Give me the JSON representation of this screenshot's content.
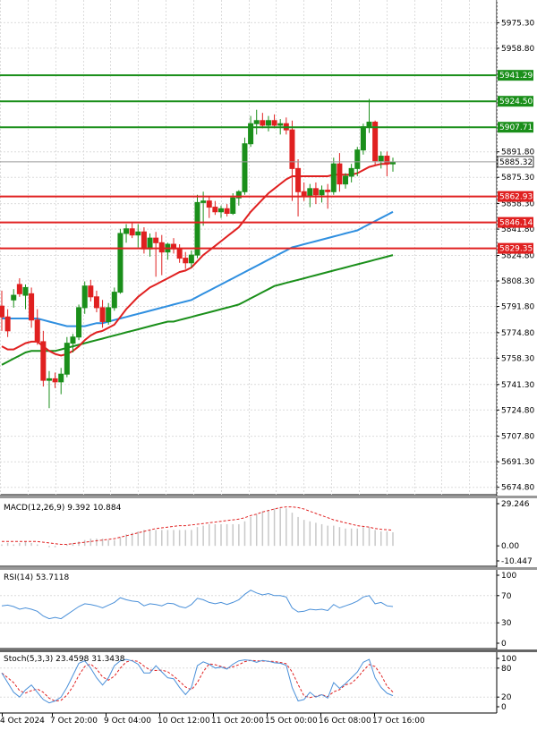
{
  "chart_data": [
    {
      "type": "candlestick",
      "y_ticks": [
        "5975.30",
        "5958.80",
        "5891.80",
        "5875.30",
        "5858.30",
        "5841.80",
        "5824.80",
        "5808.30",
        "5791.80",
        "5774.80",
        "5758.30",
        "5741.30",
        "5724.80",
        "5707.80",
        "5691.30",
        "5674.80"
      ],
      "ylim": [
        5670,
        5990
      ],
      "levels": [
        {
          "value": 5941.29,
          "label": "5941.29",
          "color": "#1a8f1a"
        },
        {
          "value": 5924.5,
          "label": "5924.50",
          "color": "#1a8f1a"
        },
        {
          "value": 5907.71,
          "label": "5907.71",
          "color": "#1a8f1a"
        },
        {
          "value": 5862.93,
          "label": "5862.93",
          "color": "#e02020"
        },
        {
          "value": 5846.14,
          "label": "5846.14",
          "color": "#e02020"
        },
        {
          "value": 5829.35,
          "label": "5829.35",
          "color": "#e02020"
        }
      ],
      "last_price": {
        "value": 5885.32,
        "label": "5885.32"
      },
      "candles": [
        {
          "o": 5792,
          "h": 5802,
          "l": 5776,
          "c": 5785
        },
        {
          "o": 5785,
          "h": 5790,
          "l": 5772,
          "c": 5776
        },
        {
          "o": 5796,
          "h": 5803,
          "l": 5791,
          "c": 5799
        },
        {
          "o": 5806,
          "h": 5810,
          "l": 5798,
          "c": 5800
        },
        {
          "o": 5799,
          "h": 5806,
          "l": 5790,
          "c": 5804
        },
        {
          "o": 5800,
          "h": 5804,
          "l": 5778,
          "c": 5783
        },
        {
          "o": 5783,
          "h": 5790,
          "l": 5767,
          "c": 5769
        },
        {
          "o": 5769,
          "h": 5776,
          "l": 5740,
          "c": 5744
        },
        {
          "o": 5744,
          "h": 5750,
          "l": 5726,
          "c": 5745
        },
        {
          "o": 5745,
          "h": 5749,
          "l": 5739,
          "c": 5743
        },
        {
          "o": 5743,
          "h": 5752,
          "l": 5735,
          "c": 5748
        },
        {
          "o": 5748,
          "h": 5772,
          "l": 5746,
          "c": 5768
        },
        {
          "o": 5768,
          "h": 5774,
          "l": 5762,
          "c": 5772
        },
        {
          "o": 5772,
          "h": 5793,
          "l": 5770,
          "c": 5791
        },
        {
          "o": 5791,
          "h": 5808,
          "l": 5787,
          "c": 5805
        },
        {
          "o": 5805,
          "h": 5809,
          "l": 5795,
          "c": 5798
        },
        {
          "o": 5798,
          "h": 5802,
          "l": 5788,
          "c": 5791
        },
        {
          "o": 5791,
          "h": 5796,
          "l": 5778,
          "c": 5782
        },
        {
          "o": 5782,
          "h": 5794,
          "l": 5780,
          "c": 5791
        },
        {
          "o": 5791,
          "h": 5804,
          "l": 5789,
          "c": 5801
        },
        {
          "o": 5801,
          "h": 5842,
          "l": 5800,
          "c": 5839
        },
        {
          "o": 5839,
          "h": 5845,
          "l": 5833,
          "c": 5842
        },
        {
          "o": 5842,
          "h": 5846,
          "l": 5836,
          "c": 5838
        },
        {
          "o": 5838,
          "h": 5845,
          "l": 5830,
          "c": 5840
        },
        {
          "o": 5840,
          "h": 5843,
          "l": 5826,
          "c": 5829
        },
        {
          "o": 5829,
          "h": 5839,
          "l": 5824,
          "c": 5836
        },
        {
          "o": 5836,
          "h": 5840,
          "l": 5811,
          "c": 5833
        },
        {
          "o": 5833,
          "h": 5838,
          "l": 5812,
          "c": 5827
        },
        {
          "o": 5827,
          "h": 5833,
          "l": 5822,
          "c": 5832
        },
        {
          "o": 5832,
          "h": 5836,
          "l": 5826,
          "c": 5829
        },
        {
          "o": 5829,
          "h": 5832,
          "l": 5820,
          "c": 5823
        },
        {
          "o": 5823,
          "h": 5827,
          "l": 5816,
          "c": 5820
        },
        {
          "o": 5820,
          "h": 5828,
          "l": 5817,
          "c": 5825
        },
        {
          "o": 5825,
          "h": 5864,
          "l": 5823,
          "c": 5859
        },
        {
          "o": 5859,
          "h": 5866,
          "l": 5844,
          "c": 5860
        },
        {
          "o": 5860,
          "h": 5863,
          "l": 5849,
          "c": 5856
        },
        {
          "o": 5856,
          "h": 5860,
          "l": 5851,
          "c": 5853
        },
        {
          "o": 5853,
          "h": 5857,
          "l": 5849,
          "c": 5855
        },
        {
          "o": 5855,
          "h": 5858,
          "l": 5850,
          "c": 5852
        },
        {
          "o": 5852,
          "h": 5865,
          "l": 5851,
          "c": 5862
        },
        {
          "o": 5862,
          "h": 5867,
          "l": 5857,
          "c": 5866
        },
        {
          "o": 5866,
          "h": 5901,
          "l": 5864,
          "c": 5897
        },
        {
          "o": 5897,
          "h": 5915,
          "l": 5895,
          "c": 5910
        },
        {
          "o": 5910,
          "h": 5919,
          "l": 5903,
          "c": 5912
        },
        {
          "o": 5912,
          "h": 5917,
          "l": 5907,
          "c": 5909
        },
        {
          "o": 5909,
          "h": 5915,
          "l": 5905,
          "c": 5912
        },
        {
          "o": 5912,
          "h": 5916,
          "l": 5907,
          "c": 5909
        },
        {
          "o": 5909,
          "h": 5913,
          "l": 5903,
          "c": 5910
        },
        {
          "o": 5910,
          "h": 5914,
          "l": 5903,
          "c": 5906
        },
        {
          "o": 5906,
          "h": 5912,
          "l": 5860,
          "c": 5881
        },
        {
          "o": 5881,
          "h": 5887,
          "l": 5850,
          "c": 5866
        },
        {
          "o": 5866,
          "h": 5872,
          "l": 5860,
          "c": 5863
        },
        {
          "o": 5863,
          "h": 5871,
          "l": 5856,
          "c": 5868
        },
        {
          "o": 5868,
          "h": 5872,
          "l": 5858,
          "c": 5864
        },
        {
          "o": 5864,
          "h": 5870,
          "l": 5859,
          "c": 5867
        },
        {
          "o": 5867,
          "h": 5871,
          "l": 5855,
          "c": 5866
        },
        {
          "o": 5866,
          "h": 5888,
          "l": 5864,
          "c": 5884
        },
        {
          "o": 5884,
          "h": 5891,
          "l": 5866,
          "c": 5871
        },
        {
          "o": 5871,
          "h": 5878,
          "l": 5868,
          "c": 5876
        },
        {
          "o": 5876,
          "h": 5884,
          "l": 5872,
          "c": 5881
        },
        {
          "o": 5881,
          "h": 5895,
          "l": 5876,
          "c": 5893
        },
        {
          "o": 5893,
          "h": 5910,
          "l": 5890,
          "c": 5908
        },
        {
          "o": 5908,
          "h": 5926,
          "l": 5904,
          "c": 5911
        },
        {
          "o": 5911,
          "h": 5912,
          "l": 5883,
          "c": 5886
        },
        {
          "o": 5886,
          "h": 5892,
          "l": 5881,
          "c": 5889
        },
        {
          "o": 5889,
          "h": 5892,
          "l": 5876,
          "c": 5884
        },
        {
          "o": 5884,
          "h": 5888,
          "l": 5879,
          "c": 5885
        }
      ],
      "ma_fast": [
        5766,
        5764,
        5764,
        5766,
        5768,
        5769,
        5769,
        5766,
        5763,
        5761,
        5760,
        5761,
        5763,
        5766,
        5770,
        5773,
        5775,
        5776,
        5778,
        5780,
        5785,
        5790,
        5794,
        5798,
        5801,
        5804,
        5806,
        5808,
        5810,
        5812,
        5814,
        5815,
        5817,
        5821,
        5825,
        5828,
        5831,
        5834,
        5837,
        5840,
        5843,
        5848,
        5853,
        5857,
        5861,
        5865,
        5868,
        5871,
        5874,
        5876,
        5876,
        5876,
        5876,
        5876,
        5876,
        5876,
        5877,
        5877,
        5877,
        5877,
        5878,
        5880,
        5882,
        5883,
        5884,
        5884,
        5885
      ],
      "ma_mid": [
        5784,
        5784,
        5784,
        5784,
        5784,
        5784,
        5784,
        5783,
        5782,
        5781,
        5780,
        5779,
        5779,
        5779,
        5779,
        5780,
        5781,
        5781,
        5782,
        5783,
        5784,
        5785,
        5786,
        5787,
        5788,
        5789,
        5790,
        5791,
        5792,
        5793,
        5794,
        5795,
        5796,
        5798,
        5800,
        5802,
        5804,
        5806,
        5808,
        5810,
        5812,
        5814,
        5816,
        5818,
        5820,
        5822,
        5824,
        5826,
        5828,
        5830,
        5831,
        5832,
        5833,
        5834,
        5835,
        5836,
        5837,
        5838,
        5839,
        5840,
        5841,
        5843,
        5845,
        5847,
        5849,
        5851,
        5853
      ],
      "ma_slow": [
        5754,
        5756,
        5758,
        5760,
        5762,
        5763,
        5763,
        5763,
        5763,
        5763,
        5764,
        5765,
        5766,
        5767,
        5768,
        5769,
        5770,
        5771,
        5772,
        5773,
        5774,
        5775,
        5776,
        5777,
        5778,
        5779,
        5780,
        5781,
        5782,
        5782,
        5783,
        5784,
        5785,
        5786,
        5787,
        5788,
        5789,
        5790,
        5791,
        5792,
        5793,
        5795,
        5797,
        5799,
        5801,
        5803,
        5805,
        5806,
        5807,
        5808,
        5809,
        5810,
        5811,
        5812,
        5813,
        5814,
        5815,
        5816,
        5817,
        5818,
        5819,
        5820,
        5821,
        5822,
        5823,
        5824,
        5825
      ]
    },
    {
      "type": "macd",
      "title": "MACD(12,26,9) 9.392 10.884",
      "y_ticks": [
        "29.246",
        "0.00",
        "-10.447"
      ],
      "ylim": [
        -10.447,
        29.246
      ],
      "histogram": [
        1,
        2,
        1,
        2,
        3,
        2,
        1,
        0,
        -1,
        -1,
        0,
        1,
        2,
        3,
        4,
        5,
        5,
        5,
        4,
        4,
        6,
        8,
        9,
        10,
        11,
        11,
        11,
        11,
        11,
        11,
        11,
        11,
        11,
        13,
        14,
        15,
        15,
        15,
        15,
        15,
        15,
        17,
        20,
        22,
        24,
        25,
        26,
        26,
        26,
        23,
        20,
        18,
        17,
        16,
        15,
        14,
        14,
        13,
        12,
        12,
        12,
        13,
        13,
        11,
        10,
        10,
        9.4
      ],
      "signal": [
        3,
        3,
        3,
        3,
        3,
        3,
        3,
        2.5,
        2,
        1.5,
        1,
        1,
        1.5,
        2,
        2.5,
        3,
        3.5,
        4,
        4.5,
        5,
        6,
        7,
        8,
        9,
        10,
        11,
        12,
        12.5,
        13,
        13.5,
        14,
        14,
        14.5,
        15,
        15.5,
        16,
        16.5,
        17,
        17.5,
        18,
        18.5,
        19.5,
        21,
        22,
        23.5,
        24.5,
        25.5,
        26.5,
        27,
        27,
        26.5,
        25.5,
        24,
        22.5,
        21,
        19.5,
        18,
        17,
        16,
        15,
        14,
        13.5,
        13,
        12,
        11.5,
        11.2,
        10.9
      ]
    },
    {
      "type": "rsi",
      "title": "RSI(14) 53.7118",
      "y_ticks": [
        "100",
        "70",
        "30",
        "0"
      ],
      "ylim": [
        0,
        100
      ],
      "values": [
        55,
        56,
        54,
        50,
        52,
        50,
        47,
        40,
        36,
        38,
        36,
        42,
        48,
        54,
        58,
        57,
        55,
        52,
        56,
        60,
        67,
        64,
        62,
        61,
        55,
        58,
        57,
        55,
        59,
        58,
        54,
        52,
        57,
        66,
        64,
        60,
        58,
        60,
        57,
        60,
        64,
        72,
        78,
        74,
        71,
        73,
        70,
        70,
        68,
        52,
        46,
        47,
        50,
        49,
        50,
        48,
        57,
        52,
        55,
        58,
        62,
        68,
        70,
        58,
        60,
        55,
        54
      ]
    },
    {
      "type": "stochastic",
      "title": "Stoch(5,3,3) 23.4598 31.3438",
      "y_ticks": [
        "100",
        "80",
        "20",
        "0"
      ],
      "ylim": [
        0,
        100
      ],
      "k": [
        70,
        50,
        30,
        20,
        35,
        45,
        30,
        15,
        8,
        12,
        20,
        40,
        65,
        90,
        95,
        80,
        60,
        45,
        60,
        85,
        95,
        98,
        95,
        88,
        70,
        70,
        85,
        72,
        60,
        58,
        40,
        25,
        40,
        85,
        93,
        88,
        80,
        82,
        78,
        88,
        95,
        97,
        96,
        92,
        96,
        94,
        91,
        90,
        86,
        40,
        12,
        15,
        30,
        20,
        25,
        18,
        50,
        38,
        48,
        60,
        72,
        92,
        98,
        60,
        40,
        28,
        23
      ]
    }
  ],
  "x_labels": [
    "4 Oct 2024",
    "7 Oct 20:00",
    "9 Oct 04:00",
    "10 Oct 12:00",
    "11 Oct 20:00",
    "15 Oct 00:00",
    "16 Oct 08:00",
    "17 Oct 16:00"
  ],
  "colors": {
    "up_candle": "#1a8f1a",
    "down_candle": "#e02020",
    "ma_fast": "#e02020",
    "ma_mid": "#2f8fe0",
    "ma_slow": "#1a8f1a",
    "grid": "#dcdcdc",
    "indicator_line": "#4a90d9",
    "indicator_signal": "#e02020",
    "histogram": "#c8c8c8"
  }
}
